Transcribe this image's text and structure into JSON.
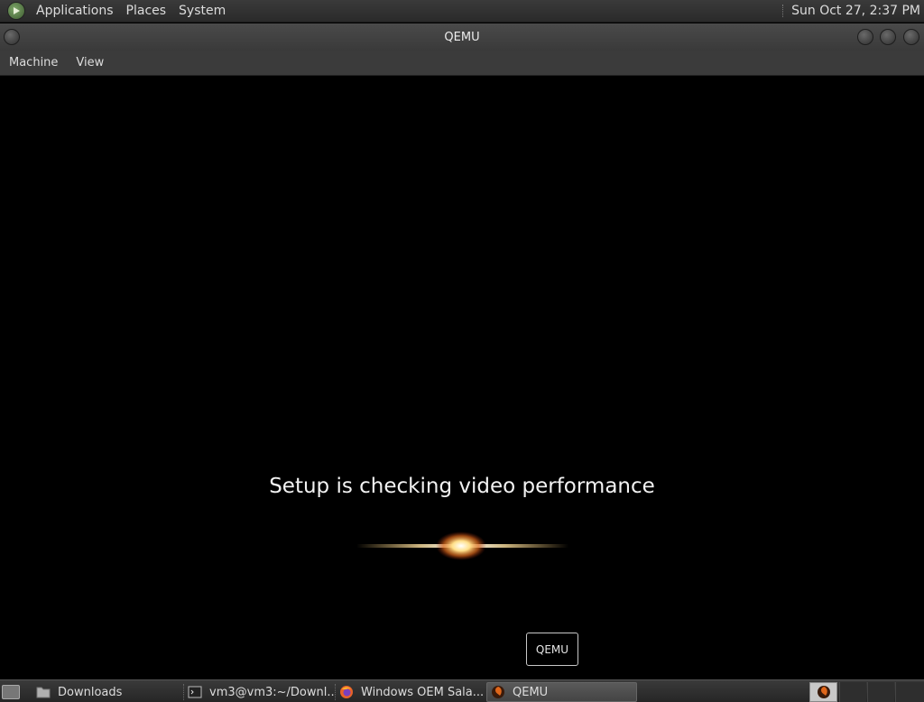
{
  "top_panel": {
    "menu": [
      "Applications",
      "Places",
      "System"
    ],
    "clock": "Sun Oct 27,  2:37 PM"
  },
  "window": {
    "title": "QEMU",
    "menubar": [
      "Machine",
      "View"
    ]
  },
  "vm": {
    "status_text": "Setup is checking video performance",
    "tooltip": "QEMU"
  },
  "taskbar": {
    "items": [
      {
        "label": "Downloads",
        "icon": "folder-icon"
      },
      {
        "label": "vm3@vm3:~/Downl...",
        "icon": "terminal-icon"
      },
      {
        "label": "Windows OEM Sala...",
        "icon": "firefox-icon"
      },
      {
        "label": "QEMU",
        "icon": "qemu-icon",
        "active": true
      }
    ]
  },
  "colors": {
    "panel_bg": "#2e2e2e",
    "screen_bg": "#000000",
    "text": "#f2f2f2"
  }
}
